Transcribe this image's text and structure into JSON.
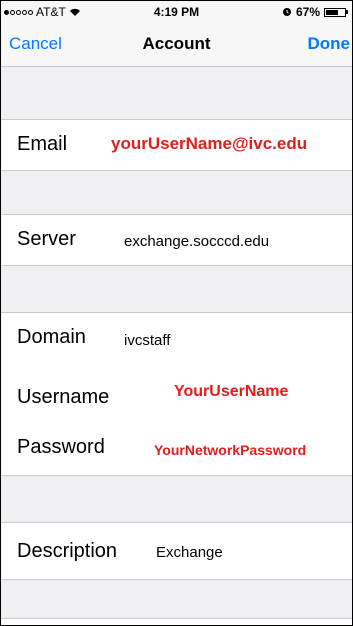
{
  "status_bar": {
    "carrier": "AT&T",
    "time": "4:19 PM",
    "battery": "67%",
    "battery_level": 0.67
  },
  "nav": {
    "cancel_label": "Cancel",
    "title": "Account",
    "done_label": "Done"
  },
  "form": {
    "email": {
      "label": "Email",
      "value": "yourUserName@ivc.edu"
    },
    "server": {
      "label": "Server",
      "value": "exchange.socccd.edu"
    },
    "domain": {
      "label": "Domain",
      "value": "ivcstaff"
    },
    "username": {
      "label": "Username",
      "value": "YourUserName"
    },
    "password": {
      "label": "Password",
      "value": "YourNetworkPassword"
    },
    "description": {
      "label": "Description",
      "value": "Exchange"
    }
  },
  "colors": {
    "accent": "#007aff",
    "highlight_red": "#e31c1c",
    "group_background": "#efeff4"
  }
}
